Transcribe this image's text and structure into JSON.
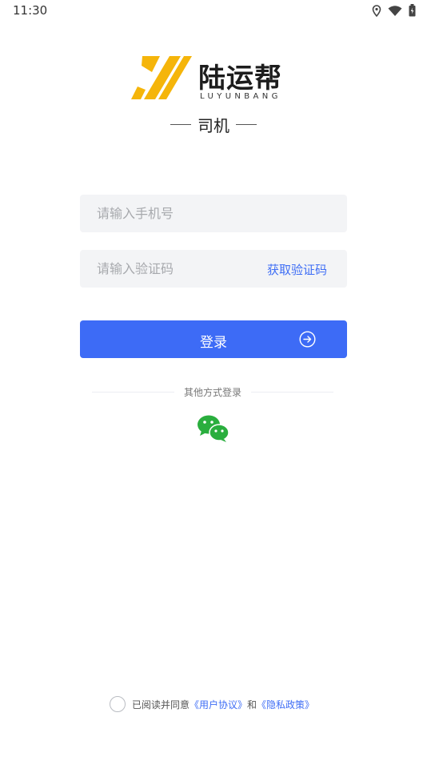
{
  "status_bar": {
    "time": "11:30",
    "icons": [
      "location-icon",
      "wifi-icon",
      "battery-icon"
    ]
  },
  "logo": {
    "title": "陆运帮",
    "subtitle": "LUYUNBANG",
    "mark_color": "#f5b50a"
  },
  "role": {
    "label": "司机"
  },
  "login_form": {
    "phone_placeholder": "请输入手机号",
    "phone_value": "",
    "code_placeholder": "请输入验证码",
    "code_value": "",
    "get_code_label": "获取验证码",
    "login_label": "登录"
  },
  "other_login": {
    "label": "其他方式登录",
    "methods": [
      "wechat-icon"
    ]
  },
  "agreement": {
    "prefix": "已阅读并同意",
    "user_agreement": "《用户协议》",
    "connector": "和",
    "privacy_policy": "《隐私政策》",
    "checked": false
  },
  "colors": {
    "primary": "#3d6bf6",
    "link": "#3f6ef5",
    "input_bg": "#f3f4f6",
    "wechat": "#2aae3e",
    "logo_yellow": "#f5b50a"
  }
}
